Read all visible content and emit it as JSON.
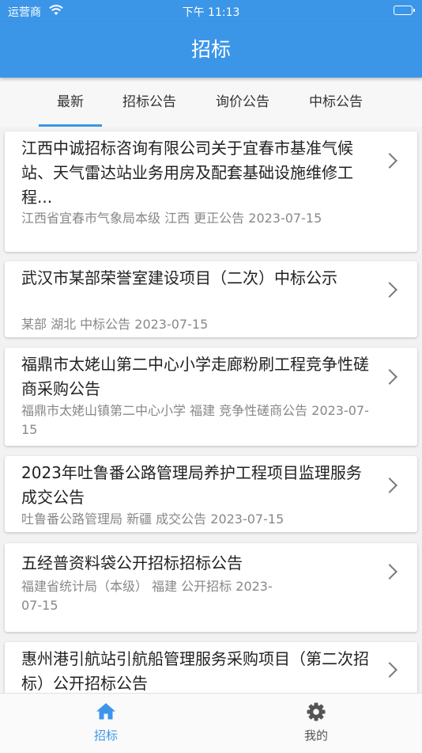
{
  "status_bar": {
    "carrier": "运营商",
    "time": "下午 11:13"
  },
  "header": {
    "title": "招标"
  },
  "tabs": [
    {
      "label": "最新",
      "active": true
    },
    {
      "label": "招标公告",
      "active": false
    },
    {
      "label": "询价公告",
      "active": false
    },
    {
      "label": "中标公告",
      "active": false
    }
  ],
  "items": [
    {
      "title": "江西中诚招标咨询有限公司关于宜春市基准气候站、天气雷达站业务用房及配套基础设施维修工程...",
      "meta": "江西省宜春市气象局本级 江西 更正公告 2023-07-15"
    },
    {
      "title": "武汉市某部荣誉室建设项目（二次）中标公示",
      "meta": "某部 湖北 中标公告 2023-07-15"
    },
    {
      "title": "福鼎市太姥山第二中心小学走廊粉刷工程竞争性磋商采购公告",
      "meta": "福鼎市太姥山镇第二中心小学 福建 竞争性磋商公告 2023-07-15"
    },
    {
      "title": "2023年吐鲁番公路管理局养护工程项目监理服务成交公告",
      "meta": "吐鲁番公路管理局 新疆 成交公告 2023-07-15"
    },
    {
      "title": "五经普资料袋公开招标招标公告",
      "meta": "福建省统计局（本级） 福建 公开招标 2023-07-15"
    },
    {
      "title": "惠州港引航站引航船管理服务采购项目（第二次招标）公开招标公告",
      "meta": ""
    }
  ],
  "bottom_nav": [
    {
      "label": "招标",
      "icon": "home-icon",
      "active": true
    },
    {
      "label": "我的",
      "icon": "gear-icon",
      "active": false
    }
  ],
  "colors": {
    "primary": "#3c96e8",
    "meta_text": "#888888",
    "background": "#f2f2f2"
  }
}
